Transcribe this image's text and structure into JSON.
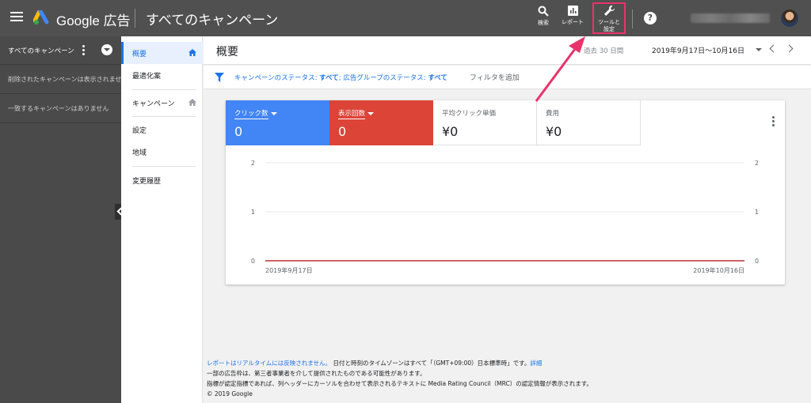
{
  "header": {
    "brand": "Google 広告",
    "campaign_title": "すべてのキャンペーン",
    "tools": {
      "search": "検索",
      "report": "レポート",
      "settings_line1": "ツールと",
      "settings_line2": "設定"
    },
    "help": "?"
  },
  "left_panel": {
    "title": "すべてのキャンペーン",
    "removed_note": "削除されたキャンペーンは表示されません",
    "empty_note": "一致するキャンペーンはありません"
  },
  "nav": {
    "items": [
      {
        "label": "概要"
      },
      {
        "label": "最適化案"
      },
      {
        "label": "キャンペーン"
      },
      {
        "label": "設定"
      },
      {
        "label": "地域"
      },
      {
        "label": "変更履歴"
      }
    ]
  },
  "page": {
    "title": "概要",
    "date_prefix": "過去 30 日間",
    "date_range": "2019年9月17日〜10月16日"
  },
  "filter": {
    "status_label": "キャンペーンのステータス: ",
    "status_value": "すべて",
    "sep": "; ",
    "adgroup_label": "広告グループのステータス: ",
    "adgroup_value": "すべて",
    "add": "フィルタを追加"
  },
  "metrics": [
    {
      "label": "クリック数",
      "value": "0",
      "color": "#4285f4"
    },
    {
      "label": "表示回数",
      "value": "0",
      "color": "#db4437"
    },
    {
      "label": "平均クリック単価",
      "value": "¥0"
    },
    {
      "label": "費用",
      "value": "¥0"
    }
  ],
  "chart_data": {
    "type": "line",
    "x": [
      "2019年9月17日",
      "2019年10月16日"
    ],
    "series": [
      {
        "values": [
          0,
          0
        ],
        "color": "#4285f4"
      },
      {
        "values": [
          0,
          0
        ],
        "color": "#db4437"
      }
    ],
    "y_ticks": [
      0,
      1,
      2
    ],
    "y_ticks_right": [
      0,
      1,
      2
    ],
    "ylim": [
      0,
      2
    ],
    "grid": true
  },
  "footer": {
    "line1_link": "レポートはリアルタイムには反映されません。",
    "line1_text": " 日付と時刻のタイムゾーンはすべて「（GMT+09:00）日本標準時」です。",
    "line1_detail": "詳細",
    "line2": "一部の広告枠は、第三者事業者を介して提供されたものである可能性があります。",
    "line3": "指標が認定指標であれば、列ヘッダーにカーソルを合わせて表示されるテキストに Media Rating Council（MRC）の認定情報が表示されます。",
    "line4": "© 2019 Google"
  },
  "colors": {
    "header_bg": "#505050",
    "accent": "#1a73e8",
    "highlight": "#e8336b"
  }
}
